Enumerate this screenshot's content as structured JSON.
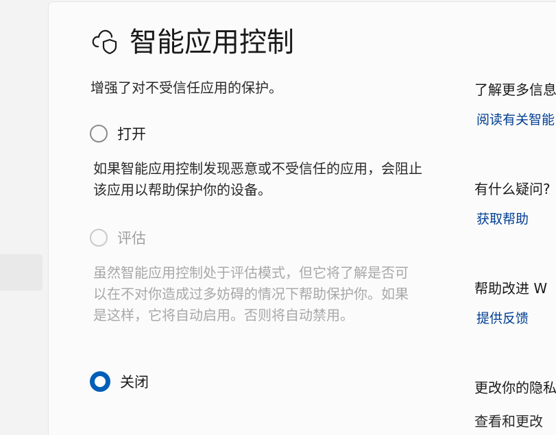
{
  "page": {
    "title": "智能应用控制",
    "subtitle": "增强了对不受信任应用的保护。"
  },
  "options": [
    {
      "label": "打开",
      "description": "如果智能应用控制发现恶意或不受信任的应用，会阻止该应用以帮助保护你的设备。",
      "state": "unselected"
    },
    {
      "label": "评估",
      "description": "虽然智能应用控制处于评估模式，但它将了解是否可以在不对你造成过多妨碍的情况下帮助保护你。如果是这样，它将自动启用。否则将自动禁用。",
      "state": "disabled"
    },
    {
      "label": "关闭",
      "state": "selected"
    }
  ],
  "sidebar": {
    "learn_more": {
      "heading": "了解更多信息",
      "link": "阅读有关智能"
    },
    "questions": {
      "heading": "有什么疑问?",
      "link": "获取帮助"
    },
    "improve": {
      "heading": "帮助改进 W",
      "link": "提供反馈"
    },
    "privacy": {
      "heading": "更改你的隐私",
      "text": "查看和更改"
    }
  },
  "icons": {
    "header_icon": "cloud-shield-icon"
  },
  "colors": {
    "accent": "#005fb8",
    "link": "#003e92",
    "disabled_text": "#a8a8a8"
  }
}
